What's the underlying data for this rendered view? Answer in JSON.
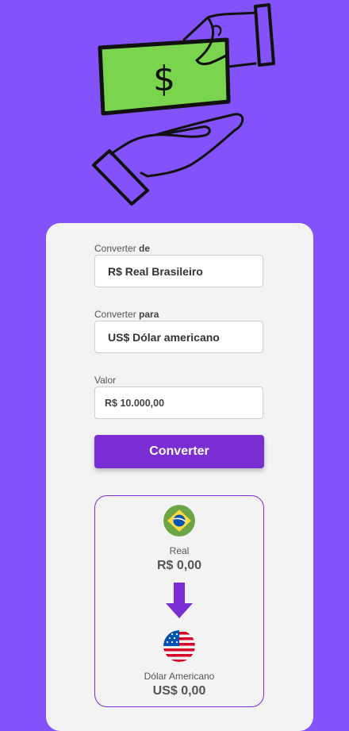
{
  "form": {
    "from_label": "Converter",
    "from_label_bold": "de",
    "from_value": "R$ Real Brasileiro",
    "to_label": "Converter",
    "to_label_bold": "para",
    "to_value": "US$ Dólar americano",
    "value_label": "Valor",
    "value_input": "R$ 10.000,00",
    "convert_button": "Converter"
  },
  "result": {
    "from_name": "Real",
    "from_amount": "R$ 0,00",
    "to_name": "Dólar Americano",
    "to_amount": "US$ 0,00"
  },
  "icons": {
    "hero": "money-exchange-hands-icon",
    "from_flag": "brazil-flag-icon",
    "to_flag": "usa-flag-icon",
    "arrow": "arrow-down-icon"
  },
  "colors": {
    "background": "#8452FB",
    "card": "#F3F3F3",
    "accent": "#7A2DD3",
    "bill_green": "#7BD44E"
  }
}
